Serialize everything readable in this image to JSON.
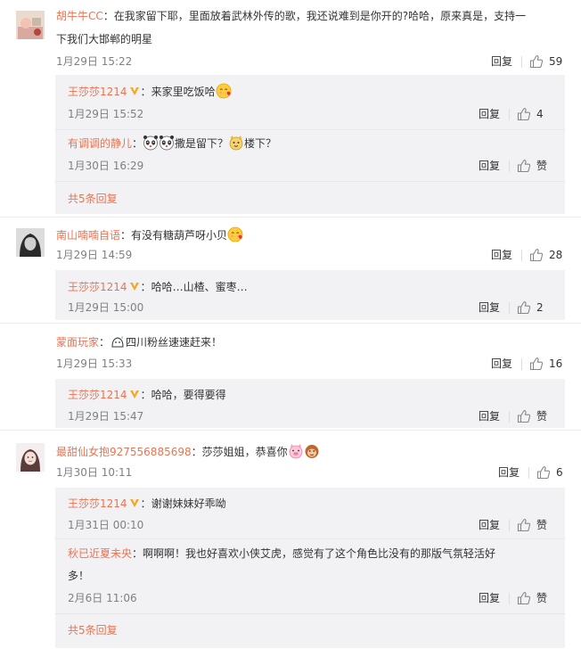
{
  "colors": {
    "accent": "#eb7350",
    "meta": "#808080",
    "reply_bg": "#f2f2f5",
    "vip": "#f5a623"
  },
  "actions": {
    "reply": "回复",
    "like": "赞"
  },
  "threads": [
    {
      "user": "胡牛牛CC",
      "sep": "：",
      "text_line1": "在我家留下耶，里面放着武林外传的歌，我还说难到是你开的?哈哈，原来真是，支持一",
      "text_line2": "下我们大邯郸的明星",
      "time": "1月29日 15:22",
      "likes": "59",
      "replies": [
        {
          "user": "王莎莎1214",
          "sep": "：",
          "text": "来家里吃饭哈",
          "time": "1月29日 15:52",
          "likes": "4"
        },
        {
          "user": "有调调的静儿",
          "sep": "：",
          "text_a": "撒是留下？",
          "text_b": "楼下？",
          "time": "1月30日 16:29",
          "likes": "赞"
        }
      ],
      "more": "共5条回复"
    },
    {
      "user": "南山喃喃自语",
      "sep": "：",
      "text": "有没有糖葫芦呀小贝",
      "time": "1月29日 14:59",
      "likes": "28",
      "replies": [
        {
          "user": "王莎莎1214",
          "sep": "：",
          "text": "哈哈…山楂、蜜枣…",
          "time": "1月29日 15:00",
          "likes": "2"
        }
      ]
    },
    {
      "user": "蒙面玩家",
      "sep": "：",
      "text": "四川粉丝速速赶来！",
      "time": "1月29日 15:33",
      "likes": "16",
      "replies": [
        {
          "user": "王莎莎1214",
          "sep": "：",
          "text": "哈哈，要得要得",
          "time": "1月29日 15:47",
          "likes": "赞"
        }
      ]
    },
    {
      "user": "最甜仙女抱927556885698",
      "sep": "：",
      "text": "莎莎姐姐，恭喜你",
      "time": "1月30日 10:11",
      "likes": "6",
      "replies": [
        {
          "user": "王莎莎1214",
          "sep": "：",
          "text": "谢谢妹妹好乖呦",
          "time": "1月31日 00:10",
          "likes": "赞"
        },
        {
          "user": "秋已近夏未央",
          "sep": "：",
          "text_line1": "啊啊啊！我也好喜欢小侠艾虎，感觉有了这个角色比没有的那版气氛轻活好",
          "text_line2": "多！",
          "time": "2月6日 11:06",
          "likes": "赞"
        }
      ],
      "more": "共5条回复"
    }
  ]
}
